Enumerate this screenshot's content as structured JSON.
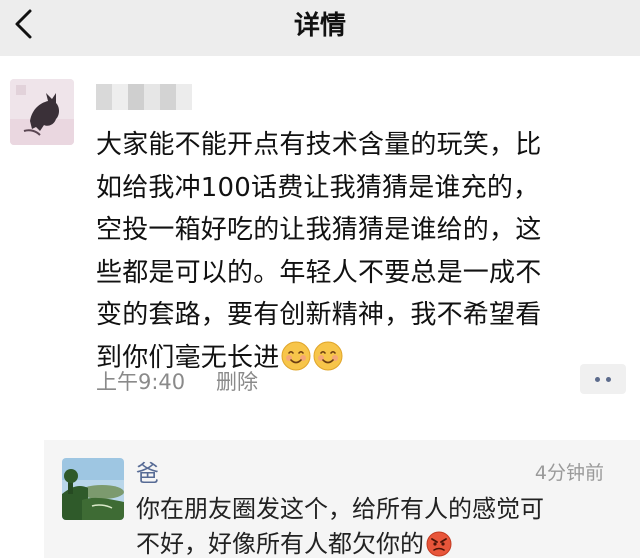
{
  "nav": {
    "title": "详情",
    "back_icon": "chevron-left-icon"
  },
  "post": {
    "text_lines": [
      "大家能不能开点有技术含量的玩笑，比",
      "如给我冲100话费让我猜猜是谁充的，",
      "空投一箱好吃的让我猜猜是谁给的，这",
      "些都是可以的。年轻人不要总是一成不",
      "变的套路，要有创新精神，我不希望看",
      "到你们毫无长进"
    ],
    "emojis": [
      "smiling-face-emoji",
      "smiling-face-emoji"
    ],
    "time": "上午9:40",
    "delete_label": "删除",
    "more_icon": "more-dots-icon"
  },
  "comment": {
    "name": "爸",
    "time": "4分钟前",
    "text_lines": [
      "你在朋友圈发这个，给所有人的感觉可",
      "不好，好像所有人都欠你的"
    ],
    "emoji": "angry-face-emoji"
  },
  "colors": {
    "navbar_bg": "#ededed",
    "link_blue": "#576b95",
    "meta_gray": "#8a8a8a",
    "comment_bg": "#f5f5f5"
  }
}
